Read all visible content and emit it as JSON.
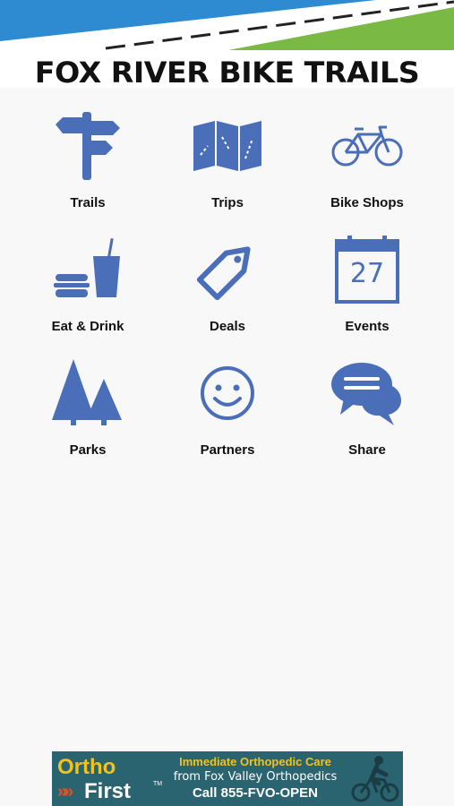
{
  "header": {
    "title": "FOX RIVER BIKE TRAILS"
  },
  "menu": [
    {
      "label": "Trails",
      "icon": "signpost-icon"
    },
    {
      "label": "Trips",
      "icon": "map-icon"
    },
    {
      "label": "Bike Shops",
      "icon": "bicycle-icon"
    },
    {
      "label": "Eat & Drink",
      "icon": "burger-drink-icon"
    },
    {
      "label": "Deals",
      "icon": "price-tag-icon"
    },
    {
      "label": "Events",
      "icon": "calendar-icon"
    },
    {
      "label": "Parks",
      "icon": "pine-trees-icon"
    },
    {
      "label": "Partners",
      "icon": "smiley-face-icon"
    },
    {
      "label": "Share",
      "icon": "speech-bubbles-icon"
    }
  ],
  "calendar_day": "27",
  "ad": {
    "brand_top": "Ortho",
    "brand_bottom": "First",
    "trademark": "TM",
    "chevrons": "»»",
    "line1": "Immediate Orthopedic Care",
    "line2": "from Fox Valley Orthopedics",
    "line3": "Call 855-FVO-OPEN"
  },
  "colors": {
    "icon_blue": "#4a6fb8",
    "banner_blue": "#2e8bd2",
    "banner_green": "#79b944",
    "ad_background": "#2a6470",
    "ad_yellow": "#f2c318"
  }
}
